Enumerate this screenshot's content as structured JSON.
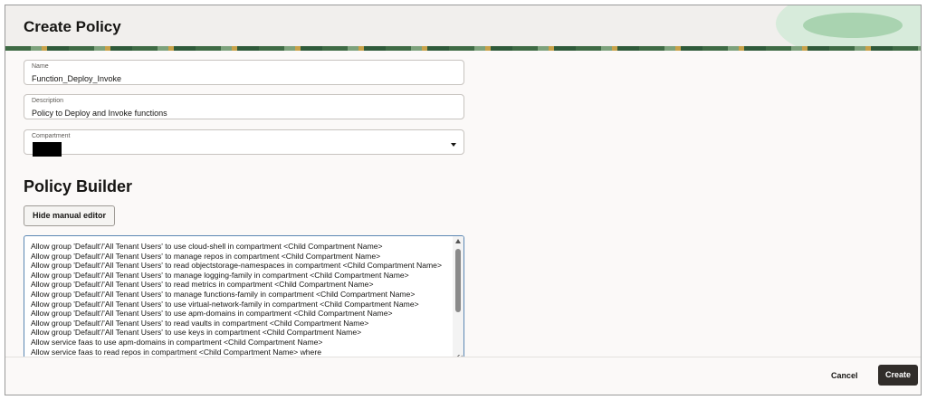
{
  "header": {
    "title": "Create Policy"
  },
  "form": {
    "name_label": "Name",
    "name_value": "Function_Deploy_Invoke",
    "description_label": "Description",
    "description_value": "Policy to Deploy and Invoke functions",
    "compartment_label": "Compartment"
  },
  "policy_builder": {
    "title": "Policy Builder",
    "toggle_editor_label": "Hide manual editor",
    "statements": [
      "Allow group 'Default'/'All Tenant Users' to use cloud-shell in compartment <Child Compartment Name>",
      "Allow group 'Default'/'All Tenant Users' to manage repos in compartment <Child Compartment Name>",
      "Allow group 'Default'/'All Tenant Users' to read objectstorage-namespaces in compartment <Child Compartment Name>",
      "Allow group 'Default'/'All Tenant Users' to manage logging-family in compartment <Child Compartment Name>",
      "Allow group 'Default'/'All Tenant Users' to read metrics in compartment <Child Compartment Name>",
      "Allow group 'Default'/'All Tenant Users' to manage functions-family in compartment <Child Compartment Name>",
      "Allow group 'Default'/'All Tenant Users' to use virtual-network-family in compartment <Child Compartment Name>",
      "Allow group 'Default'/'All Tenant Users' to use apm-domains in compartment <Child Compartment Name>",
      "Allow group 'Default'/'All Tenant Users' to read vaults in compartment <Child Compartment Name>",
      "Allow group 'Default'/'All Tenant Users' to use keys in compartment <Child Compartment Name>",
      "Allow service faas to use apm-domains in compartment <Child Compartment Name>",
      "Allow service faas to read repos in compartment <Child Compartment Name> where"
    ]
  },
  "footer": {
    "cancel_label": "Cancel",
    "create_label": "Create"
  },
  "colors": {
    "primary_button": "#312d2a",
    "editor_border": "#5b87b3",
    "header_bg": "#f1efed"
  }
}
